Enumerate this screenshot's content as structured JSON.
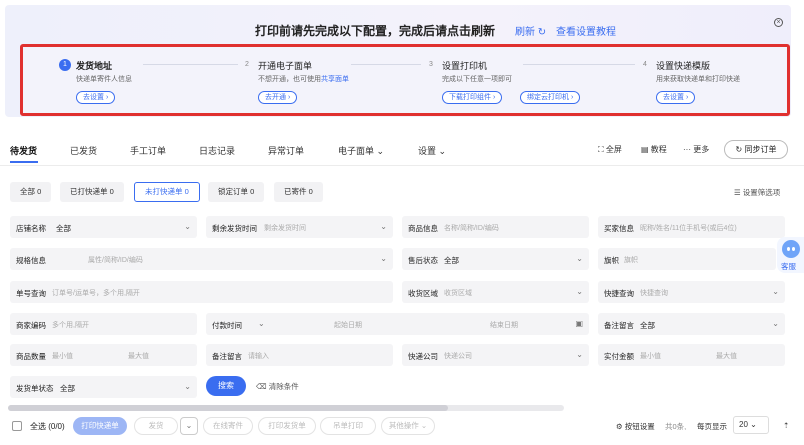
{
  "banner": {
    "title": "打印前请先完成以下配置，完成后请点击刷新",
    "refresh": "刷新",
    "refresh_icon": "↻",
    "tutorial": "查看设置教程",
    "close_icon": "×",
    "steps": [
      {
        "num": "1",
        "title": "发货地址",
        "desc": "快递单寄件人信息",
        "desc_link": "",
        "buttons": [
          "去设置 ›"
        ]
      },
      {
        "num": "2",
        "title": "开通电子面单",
        "desc": "不想开通，也可使用",
        "desc_link": "共享面单",
        "buttons": [
          "去开通 ›"
        ]
      },
      {
        "num": "3",
        "title": "设置打印机",
        "desc": "完成以下任意一项即可",
        "desc_link": "",
        "buttons": [
          "下载打印组件 ›",
          "绑定云打印机 ›"
        ]
      },
      {
        "num": "4",
        "title": "设置快递模版",
        "desc": "用来获取快递单和打印快递",
        "desc_link": "",
        "buttons": [
          "去设置 ›"
        ]
      }
    ]
  },
  "tabs": [
    {
      "label": "待发货",
      "active": true
    },
    {
      "label": "已发货"
    },
    {
      "label": "手工订单"
    },
    {
      "label": "日志记录"
    },
    {
      "label": "异常订单"
    },
    {
      "label": "电子面单 ⌄"
    },
    {
      "label": "设置 ⌄"
    }
  ],
  "toolbar_right": {
    "fullscreen": "⛶ 全屏",
    "tutorial": "▤ 教程",
    "more": "··· 更多",
    "sync": "↻ 同步订单"
  },
  "chips": [
    {
      "label": "全部 0"
    },
    {
      "label": "已打快递单 0"
    },
    {
      "label": "未打快递单 0",
      "active": true
    },
    {
      "label": "锁定订单 0"
    },
    {
      "label": "已寄件 0"
    }
  ],
  "column_setting": "☰ 设置筛选项",
  "filters": {
    "shop_label": "店铺名称",
    "shop_value": "全部",
    "remain_label": "剩余发货时间",
    "remain_ph": "剩余发货时间",
    "goods_label": "商品信息",
    "goods_ph": "名称/简称/ID/编码",
    "buyer_label": "买家信息",
    "buyer_ph": "昵称/姓名/11位手机号(或后4位)",
    "spec_label": "规格信息",
    "spec_ph": "属性/简称/ID/编码",
    "aftersale_label": "售后状态",
    "aftersale_value": "全部",
    "flag_label": "旗帜",
    "flag_ph": "旗帜",
    "orderno_label": "单号查询",
    "orderno_ph": "订单号/运单号，多个用,隔开",
    "region_label": "收货区域",
    "region_ph": "收货区域",
    "quick_label": "快捷查询",
    "quick_ph": "快捷查询",
    "merchant_label": "商家编码",
    "merchant_ph": "多个用,隔开",
    "paytime_label": "付款时间",
    "start_ph": "起始日期",
    "end_ph": "结束日期",
    "remark_label": "备注留言",
    "remark_value": "全部",
    "qty_label": "商品数量",
    "qty_min": "最小值",
    "qty_max": "最大值",
    "remark2_label": "备注留言",
    "remark2_ph": "请输入",
    "express_label": "快递公司",
    "express_ph": "快递公司",
    "amount_label": "实付金额",
    "amount_min": "最小值",
    "amount_max": "最大值",
    "shipstatus_label": "发货单状态",
    "shipstatus_value": "全部"
  },
  "search_btn": "搜索",
  "clear_btn": "⌫ 清除条件",
  "bottom": {
    "select_all": "全选 (0/0)",
    "print_express": "打印快递单",
    "ship": "发货",
    "online_ship": "在线寄件",
    "print_ship": "打印发货单",
    "print_tag": "吊单打印",
    "other_ops": "其他操作 ⌄",
    "btn_setting": "⚙ 按钮设置",
    "total": "共0条,",
    "per_page": "每页显示",
    "page_size": "20",
    "top_icon": "⇡"
  },
  "service": {
    "label": "客服"
  }
}
